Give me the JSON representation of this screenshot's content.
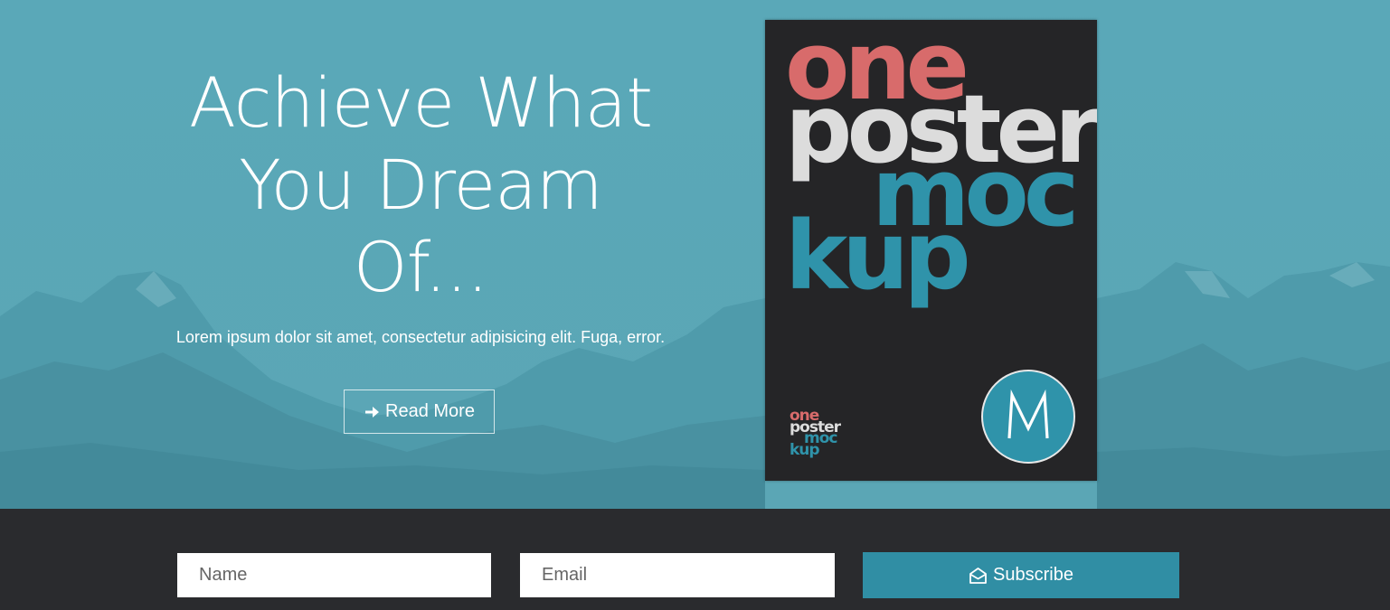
{
  "hero": {
    "headline_lines": [
      "Achieve What",
      "You Dream",
      "Of..."
    ],
    "subtext": "Lorem ipsum dolor sit amet, consectetur adipisicing elit. Fuga, error.",
    "cta_label": "Read More",
    "cta_icon": "arrow-right-icon"
  },
  "poster": {
    "line1": "one",
    "line2": "poster",
    "line3": "moc",
    "line4": "kup",
    "logo_letter": "M",
    "colors": {
      "background": "#252527",
      "one": "#d86b6b",
      "poster": "#dcdcdc",
      "accent": "#2f93aa"
    }
  },
  "subscribe": {
    "name_placeholder": "Name",
    "email_placeholder": "Email",
    "button_label": "Subscribe",
    "button_icon": "envelope-open-icon"
  },
  "colors": {
    "hero_bg": "#5aa7b6",
    "footer_bg": "#2a2b2e",
    "button_bg": "#308ea4"
  }
}
